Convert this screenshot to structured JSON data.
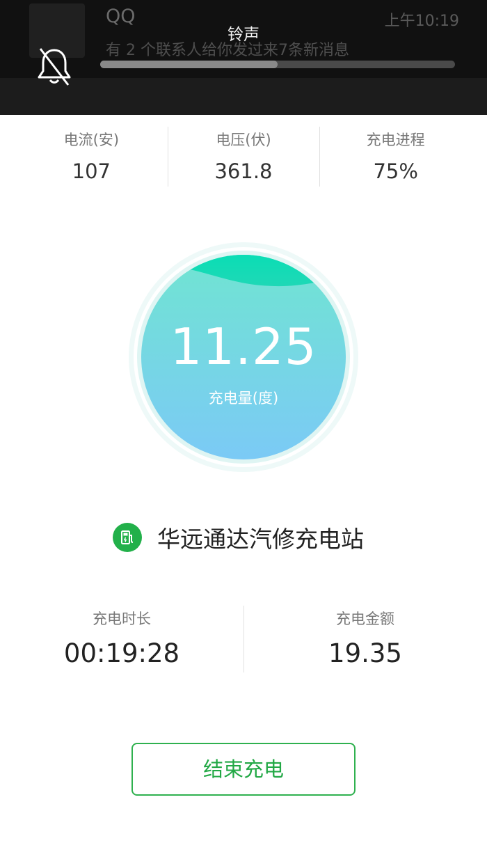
{
  "notification": {
    "app_title": "QQ",
    "time": "上午10:19",
    "message": "有 2 个联系人给你发过来7条新消息"
  },
  "volume_panel": {
    "title": "铃声",
    "icon": "bell-muted-icon",
    "level": 0.5
  },
  "stats": [
    {
      "label": "电流(安)",
      "value": "107"
    },
    {
      "label": "电压(伏)",
      "value": "361.8"
    },
    {
      "label": "充电进程",
      "value": "75%"
    }
  ],
  "gauge": {
    "value": "11.25",
    "label": "充电量(度)",
    "progress": 0.75,
    "colors": {
      "top": "#00e0b4",
      "bottom": "#7cc8f8",
      "ring": "#e3f7f6"
    }
  },
  "station": {
    "icon": "fuel-pump-icon",
    "name": "华远通达汽修充电站",
    "icon_color": "#22b04a"
  },
  "metrics": [
    {
      "label": "充电时长",
      "value": "00:19:28"
    },
    {
      "label": "充电金额",
      "value": "19.35"
    }
  ],
  "end_button": {
    "label": "结束充电",
    "color": "#22a845"
  }
}
